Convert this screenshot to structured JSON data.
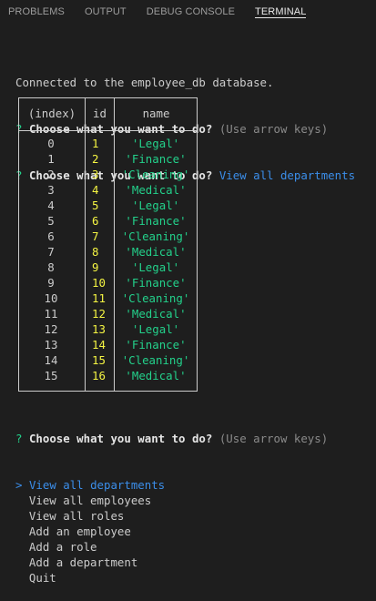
{
  "tabs": [
    "PROBLEMS",
    "OUTPUT",
    "DEBUG CONSOLE",
    "TERMINAL"
  ],
  "active_tab": "TERMINAL",
  "terminal": {
    "connected_msg": "Connected to the employee_db database.",
    "prompt_mark": "?",
    "question": "Choose what you want to do?",
    "hint": "(Use arrow keys)",
    "answer": "View all departments"
  },
  "table": {
    "headers": [
      "(index)",
      "id",
      "name"
    ],
    "rows": [
      {
        "index": "0",
        "id": "1",
        "name": "'Legal'"
      },
      {
        "index": "1",
        "id": "2",
        "name": "'Finance'"
      },
      {
        "index": "2",
        "id": "3",
        "name": "'Cleaning'"
      },
      {
        "index": "3",
        "id": "4",
        "name": "'Medical'"
      },
      {
        "index": "4",
        "id": "5",
        "name": "'Legal'"
      },
      {
        "index": "5",
        "id": "6",
        "name": "'Finance'"
      },
      {
        "index": "6",
        "id": "7",
        "name": "'Cleaning'"
      },
      {
        "index": "7",
        "id": "8",
        "name": "'Medical'"
      },
      {
        "index": "8",
        "id": "9",
        "name": "'Legal'"
      },
      {
        "index": "9",
        "id": "10",
        "name": "'Finance'"
      },
      {
        "index": "10",
        "id": "11",
        "name": "'Cleaning'"
      },
      {
        "index": "11",
        "id": "12",
        "name": "'Medical'"
      },
      {
        "index": "12",
        "id": "13",
        "name": "'Legal'"
      },
      {
        "index": "13",
        "id": "14",
        "name": "'Finance'"
      },
      {
        "index": "14",
        "id": "15",
        "name": "'Cleaning'"
      },
      {
        "index": "15",
        "id": "16",
        "name": "'Medical'"
      }
    ]
  },
  "menu": {
    "pointer": ">",
    "options": [
      "View all departments",
      "View all employees",
      "View all roles",
      "Add an employee",
      "Add a role",
      "Add a department",
      "Quit"
    ],
    "selected_index": 0
  },
  "colors": {
    "background": "#1e1e1e",
    "prompt_green": "#23d18b",
    "answer_blue": "#3b8eea",
    "number_yellow": "#f5f543",
    "string_green": "#23d18b"
  }
}
